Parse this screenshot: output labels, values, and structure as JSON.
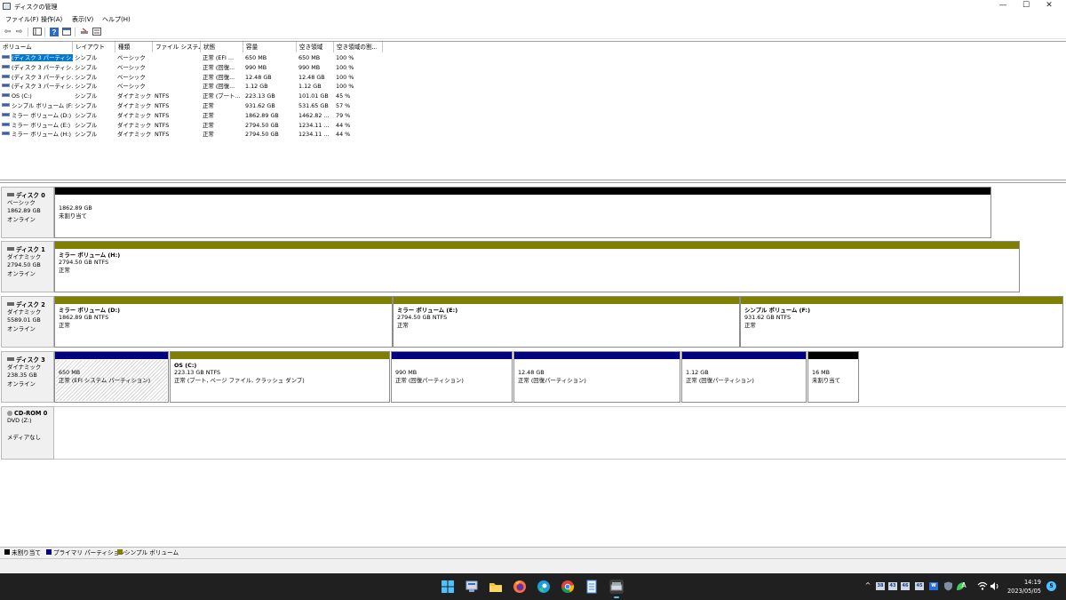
{
  "window": {
    "title": "ディスクの管理",
    "minimize": "—",
    "maximize": "☐",
    "close": "✕"
  },
  "menu": [
    "ファイル(F)",
    "操作(A)",
    "表示(V)",
    "ヘルプ(H)"
  ],
  "toolbar": {
    "back": "⇦",
    "forward": "⇨"
  },
  "volume_list": {
    "headers": [
      "ボリューム",
      "レイアウト",
      "種類",
      "ファイル システム",
      "状態",
      "容量",
      "空き領域",
      "空き領域の割..."
    ],
    "rows": [
      [
        "(ディスク 3 パーティシ...",
        "シンプル",
        "ベーシック",
        "",
        "正常 (EFI ...",
        "650 MB",
        "650 MB",
        "100 %"
      ],
      [
        "(ディスク 3 パーティシ...",
        "シンプル",
        "ベーシック",
        "",
        "正常 (回復...",
        "990 MB",
        "990 MB",
        "100 %"
      ],
      [
        "(ディスク 3 パーティシ...",
        "シンプル",
        "ベーシック",
        "",
        "正常 (回復...",
        "12.48 GB",
        "12.48 GB",
        "100 %"
      ],
      [
        "(ディスク 3 パーティシ...",
        "シンプル",
        "ベーシック",
        "",
        "正常 (回復...",
        "1.12 GB",
        "1.12 GB",
        "100 %"
      ],
      [
        "OS (C:)",
        "シンプル",
        "ダイナミック",
        "NTFS",
        "正常 (ブート...",
        "223.13 GB",
        "101.01 GB",
        "45 %"
      ],
      [
        "シンプル ボリューム (F:)",
        "シンプル",
        "ダイナミック",
        "NTFS",
        "正常",
        "931.62 GB",
        "531.65 GB",
        "57 %"
      ],
      [
        "ミラー ボリューム (D:)",
        "シンプル",
        "ダイナミック",
        "NTFS",
        "正常",
        "1862.89 GB",
        "1462.82 ...",
        "79 %"
      ],
      [
        "ミラー ボリューム (E:)",
        "シンプル",
        "ダイナミック",
        "NTFS",
        "正常",
        "2794.50 GB",
        "1234.11 ...",
        "44 %"
      ],
      [
        "ミラー ボリューム (H:)",
        "シンプル",
        "ダイナミック",
        "NTFS",
        "正常",
        "2794.50 GB",
        "1234.11 ...",
        "44 %"
      ]
    ]
  },
  "disks": [
    {
      "name": "ディスク 0",
      "type": "ベーシック",
      "size": "1862.89 GB",
      "status": "オンライン",
      "partitions": [
        {
          "lines": [
            "1862.89 GB",
            "未割り当て"
          ],
          "color": "#000000"
        }
      ]
    },
    {
      "name": "ディスク 1",
      "type": "ダイナミック",
      "size": "2794.50 GB",
      "status": "オンライン",
      "partitions": [
        {
          "title": "ミラー ボリューム (H:)",
          "lines": [
            "2794.50 GB NTFS",
            "正常"
          ],
          "color": "#808000"
        }
      ]
    },
    {
      "name": "ディスク 2",
      "type": "ダイナミック",
      "size": "5589.01 GB",
      "status": "オンライン",
      "partitions": [
        {
          "title": "ミラー ボリューム (D:)",
          "lines": [
            "1862.89 GB NTFS",
            "正常"
          ],
          "color": "#808000"
        },
        {
          "title": "ミラー ボリューム (E:)",
          "lines": [
            "2794.50 GB NTFS",
            "正常"
          ],
          "color": "#808000"
        },
        {
          "title": "シンプル ボリューム (F:)",
          "lines": [
            "931.62 GB NTFS",
            "正常"
          ],
          "color": "#808000"
        }
      ]
    },
    {
      "name": "ディスク 3",
      "type": "ダイナミック",
      "size": "238.35 GB",
      "status": "オンライン",
      "partitions": [
        {
          "lines": [
            "650 MB",
            "正常 (EFI システム パーティション)"
          ],
          "color": "#000080",
          "hatched": true
        },
        {
          "title": "OS (C:)",
          "lines": [
            "223.13 GB NTFS",
            "正常 (ブート, ページ ファイル, クラッシュ ダンプ)"
          ],
          "color": "#808000"
        },
        {
          "lines": [
            "990 MB",
            "正常 (回復パーティション)"
          ],
          "color": "#000080"
        },
        {
          "lines": [
            "12.48 GB",
            "正常 (回復パーティション)"
          ],
          "color": "#000080"
        },
        {
          "lines": [
            "1.12 GB",
            "正常 (回復パーティション)"
          ],
          "color": "#000080"
        },
        {
          "lines": [
            "16 MB",
            "未割り当て"
          ],
          "color": "#000000"
        }
      ]
    },
    {
      "name": "CD-ROM 0",
      "type": "DVD (Z:)",
      "size": "",
      "status": "メディアなし",
      "partitions": []
    }
  ],
  "legend": [
    {
      "label": "未割り当て",
      "color": "#000000"
    },
    {
      "label": "プライマリ パーティション",
      "color": "#000080"
    },
    {
      "label": "シンプル ボリューム",
      "color": "#808000"
    }
  ],
  "taskbar": {
    "apps": [
      "start-icon",
      "server-manager-icon",
      "file-explorer-icon",
      "firefox-icon",
      "edge-icon",
      "chrome-icon",
      "notepad-icon",
      "disk-management-icon"
    ],
    "tray_chevron": "^",
    "tray_badges": [
      "38",
      "43",
      "46",
      "45",
      "W"
    ],
    "ime": "A",
    "time": "14:19",
    "date": "2023/05/05",
    "notifications": "5"
  }
}
